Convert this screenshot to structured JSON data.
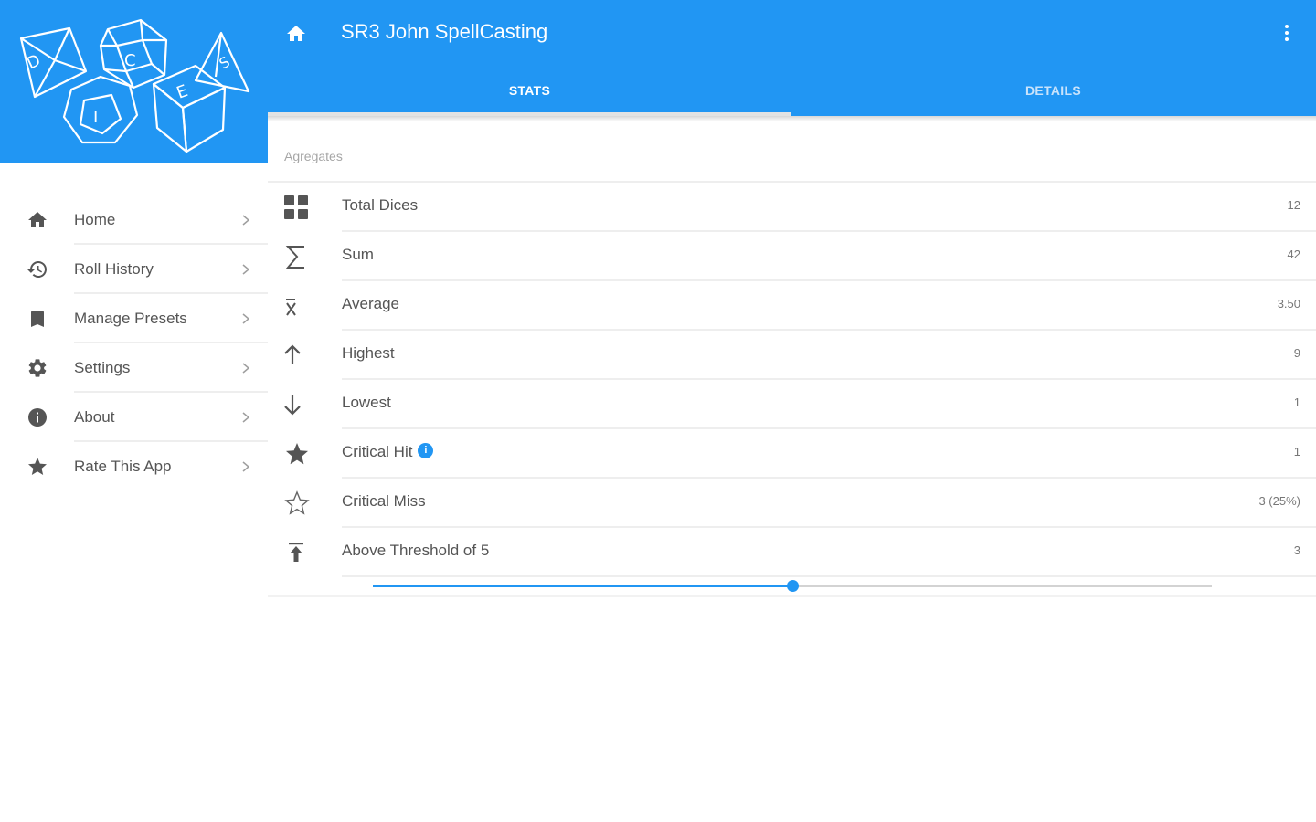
{
  "app": {
    "title": "SR3 John SpellCasting",
    "accent": "#2196f3"
  },
  "sidebar": {
    "logo": {
      "icon": "dice-logo-icon",
      "letters": [
        "D",
        "I",
        "C",
        "E",
        "S"
      ]
    },
    "items": [
      {
        "label": "Home",
        "icon": "home-icon"
      },
      {
        "label": "Roll History",
        "icon": "history-icon"
      },
      {
        "label": "Manage Presets",
        "icon": "bookmark-icon"
      },
      {
        "label": "Settings",
        "icon": "gear-icon"
      },
      {
        "label": "About",
        "icon": "info-icon"
      },
      {
        "label": "Rate This App",
        "icon": "star-icon"
      }
    ]
  },
  "tabs": [
    {
      "label": "STATS",
      "active": true
    },
    {
      "label": "DETAILS",
      "active": false
    }
  ],
  "section": {
    "label": "Agregates"
  },
  "stats": [
    {
      "label": "Total Dices",
      "value": "12",
      "icon": "grid-icon"
    },
    {
      "label": "Sum",
      "value": "42",
      "icon": "sigma-icon"
    },
    {
      "label": "Average",
      "value": "3.50",
      "icon": "x-bar-icon"
    },
    {
      "label": "Highest",
      "value": "9",
      "icon": "arrow-up-icon"
    },
    {
      "label": "Lowest",
      "value": "1",
      "icon": "arrow-down-icon"
    },
    {
      "label": "Critical Hit",
      "value": "1",
      "icon": "star-filled-icon",
      "badge": "i"
    },
    {
      "label": "Critical Miss",
      "value": "3 (25%)",
      "icon": "star-outline-icon"
    },
    {
      "label": "Above Threshold of 5",
      "value": "3",
      "icon": "upload-icon"
    }
  ],
  "threshold_slider": {
    "value_fraction": 0.5
  }
}
